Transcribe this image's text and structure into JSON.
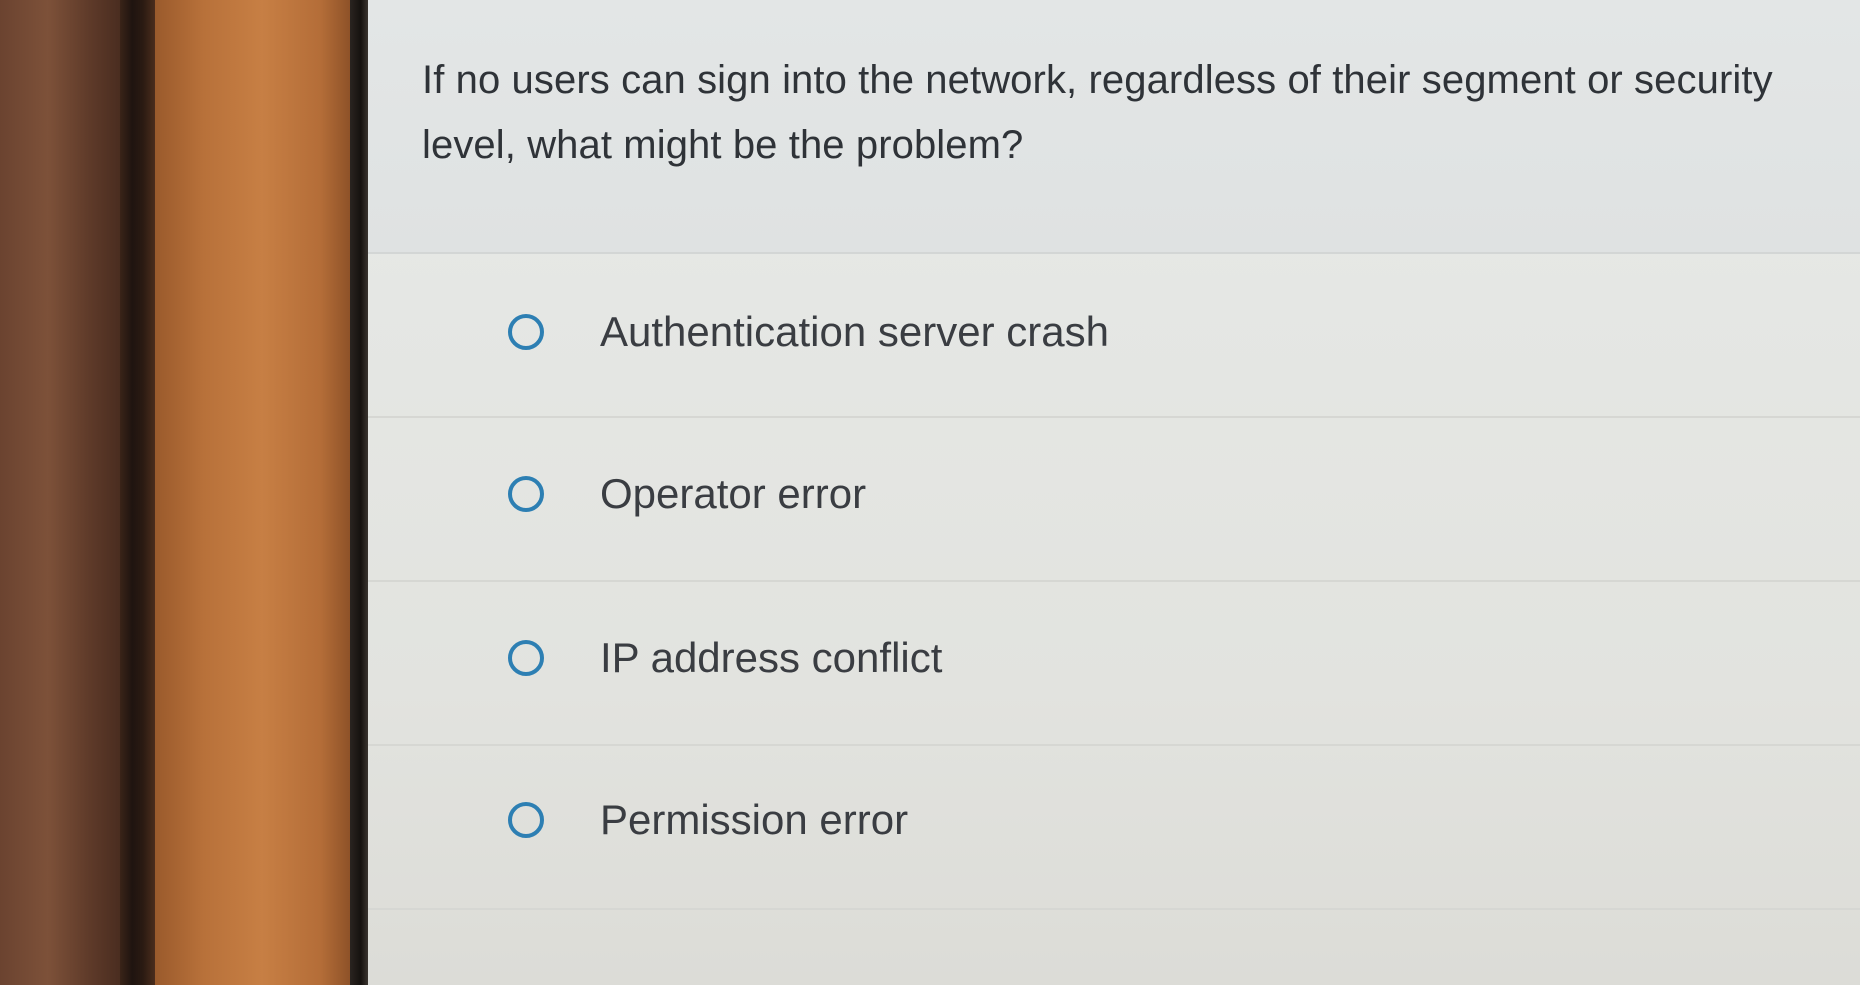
{
  "question": {
    "text": "If no users can sign into the network, regardless of their segment or security level, what might be the problem?"
  },
  "options": [
    {
      "label": "Authentication server crash",
      "selected": false
    },
    {
      "label": "Operator error",
      "selected": false
    },
    {
      "label": "IP address conflict",
      "selected": false
    },
    {
      "label": "Permission error",
      "selected": false
    }
  ],
  "colors": {
    "radio_accent": "#2d7fb3",
    "question_text": "#2f3338",
    "option_text": "#3a3d42"
  }
}
